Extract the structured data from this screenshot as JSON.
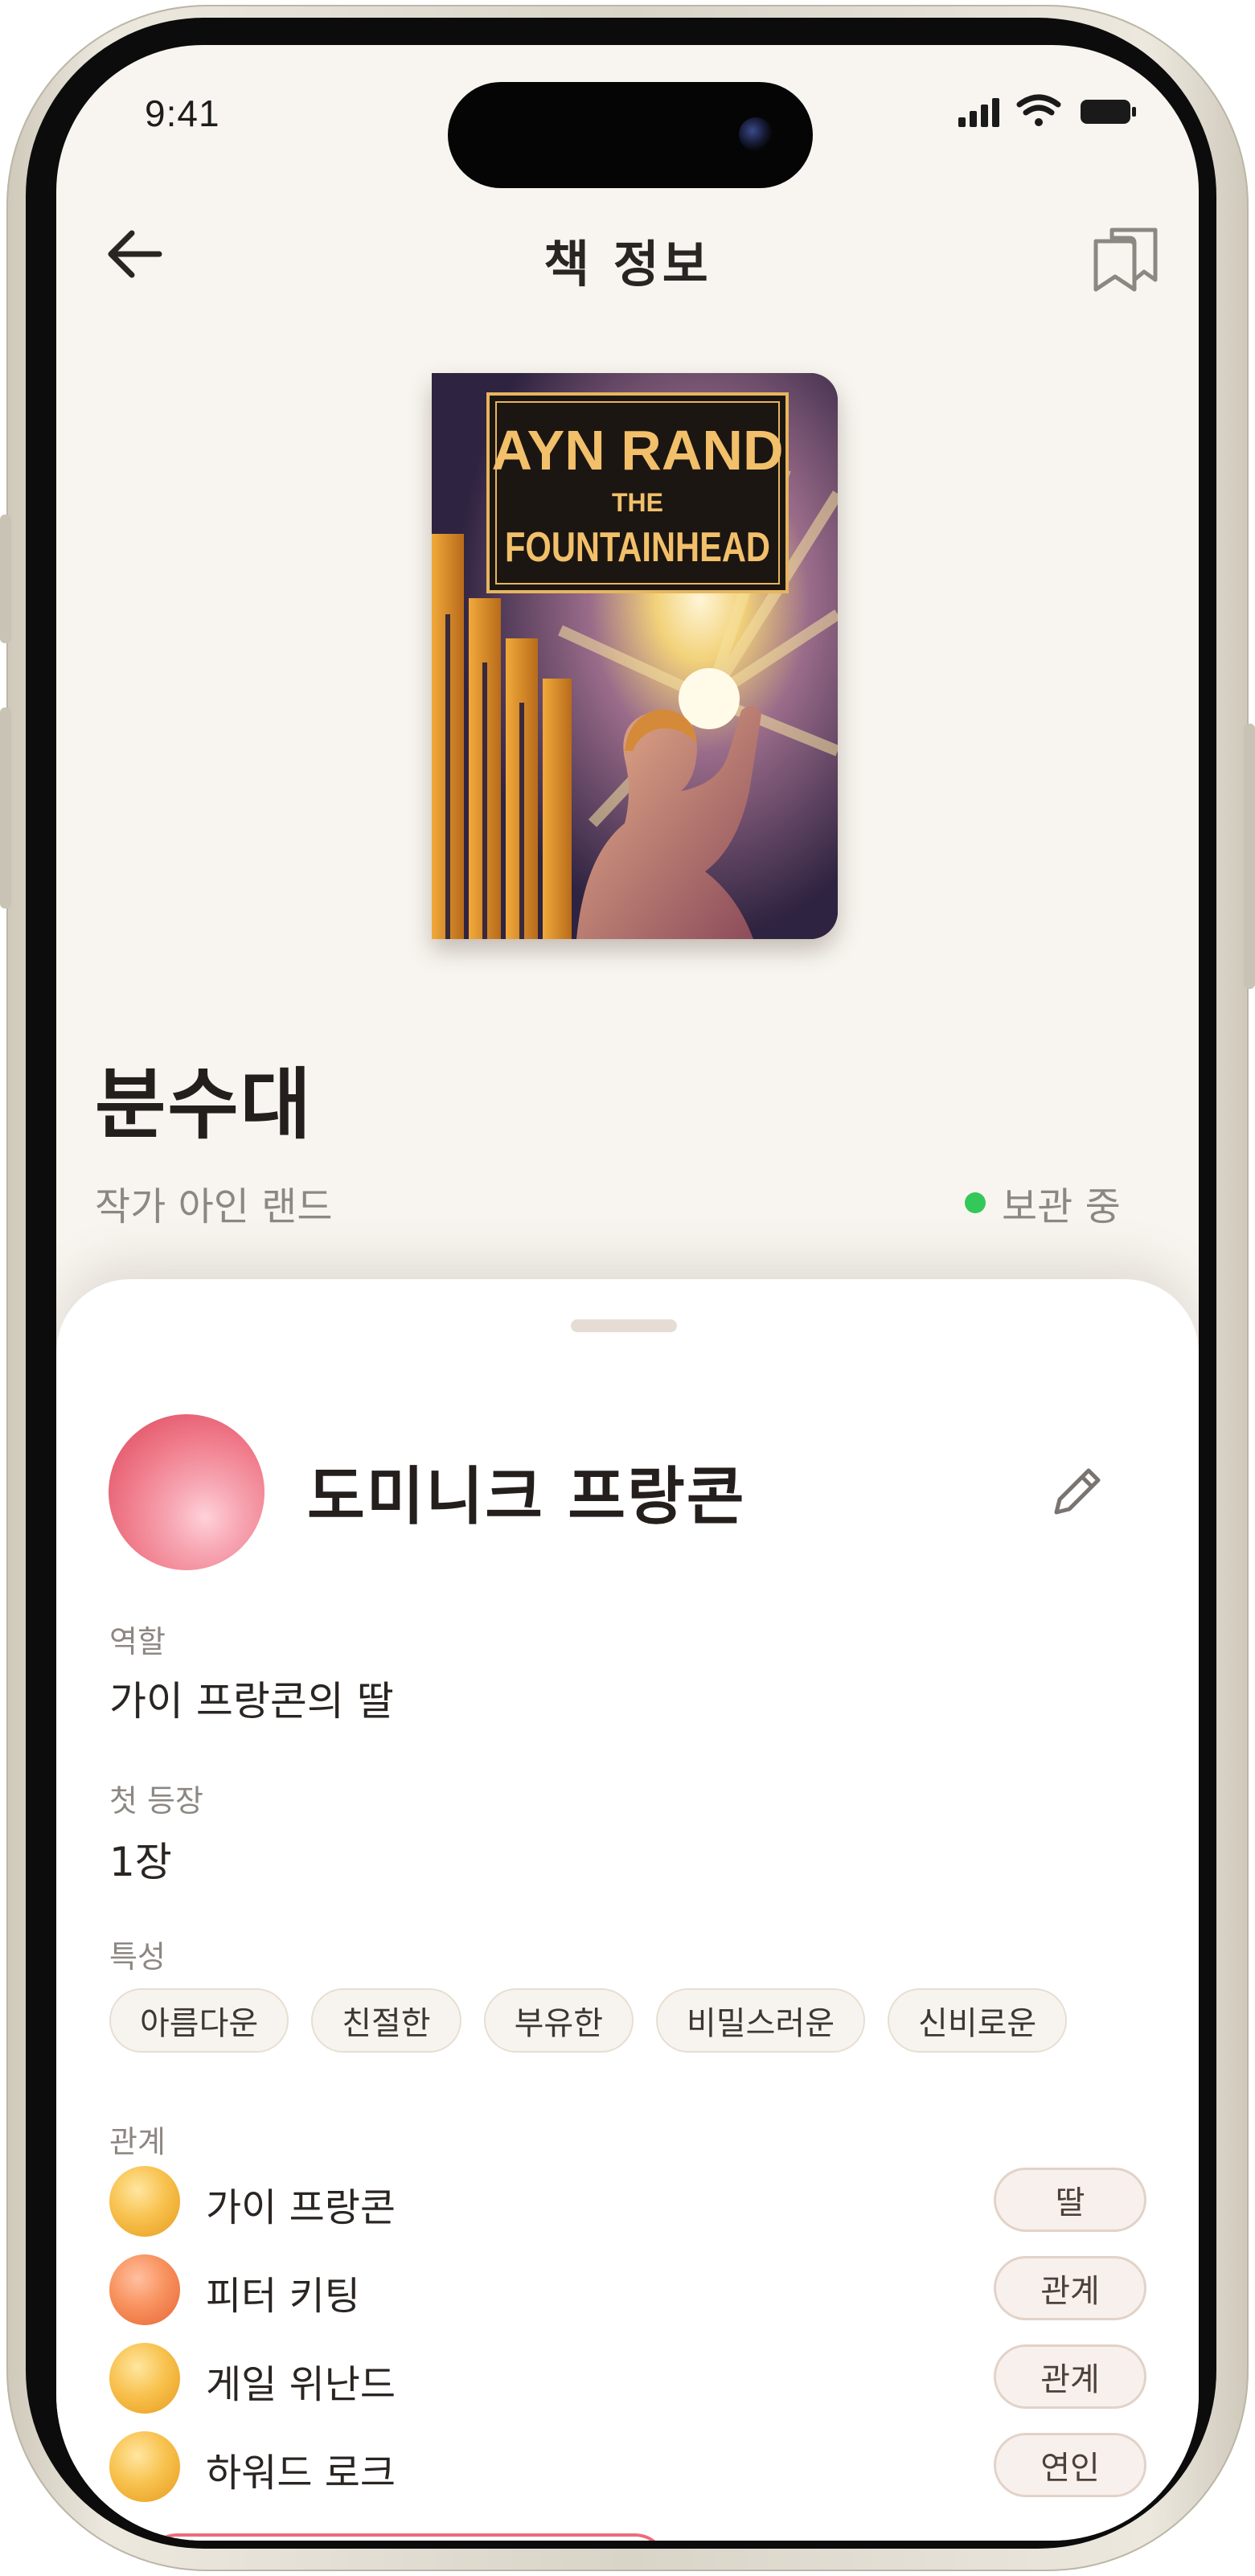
{
  "status_bar": {
    "time": "9:41"
  },
  "nav": {
    "title": "책 정보"
  },
  "book": {
    "cover": {
      "author": "AYN RAND",
      "subtitle": "THE",
      "title": "FOUNTAINHEAD"
    },
    "title": "분수대",
    "author": "작가 아인 랜드",
    "status": "보관 중",
    "status_color": "#34c759"
  },
  "character": {
    "name": "도미니크 프랑콘",
    "role_label": "역할",
    "role": "가이 프랑콘의 딸",
    "first_label": "첫 등장",
    "first": "1장",
    "traits_label": "특성",
    "traits": [
      "아름다운",
      "친절한",
      "부유한",
      "비밀스러운",
      "신비로운"
    ],
    "relations_label": "관계",
    "relations": [
      {
        "name": "가이 프랑콘",
        "tag": "딸",
        "color": "yellow"
      },
      {
        "name": "피터 키팅",
        "tag": "관계",
        "color": "orange"
      },
      {
        "name": "게일 위난드",
        "tag": "관계",
        "color": "yellow"
      },
      {
        "name": "하워드 로크",
        "tag": "연인",
        "color": "yellow"
      }
    ]
  },
  "icons": {
    "back": "arrow-left-icon",
    "action": "bookmarks-icon",
    "edit": "pencil-icon"
  }
}
